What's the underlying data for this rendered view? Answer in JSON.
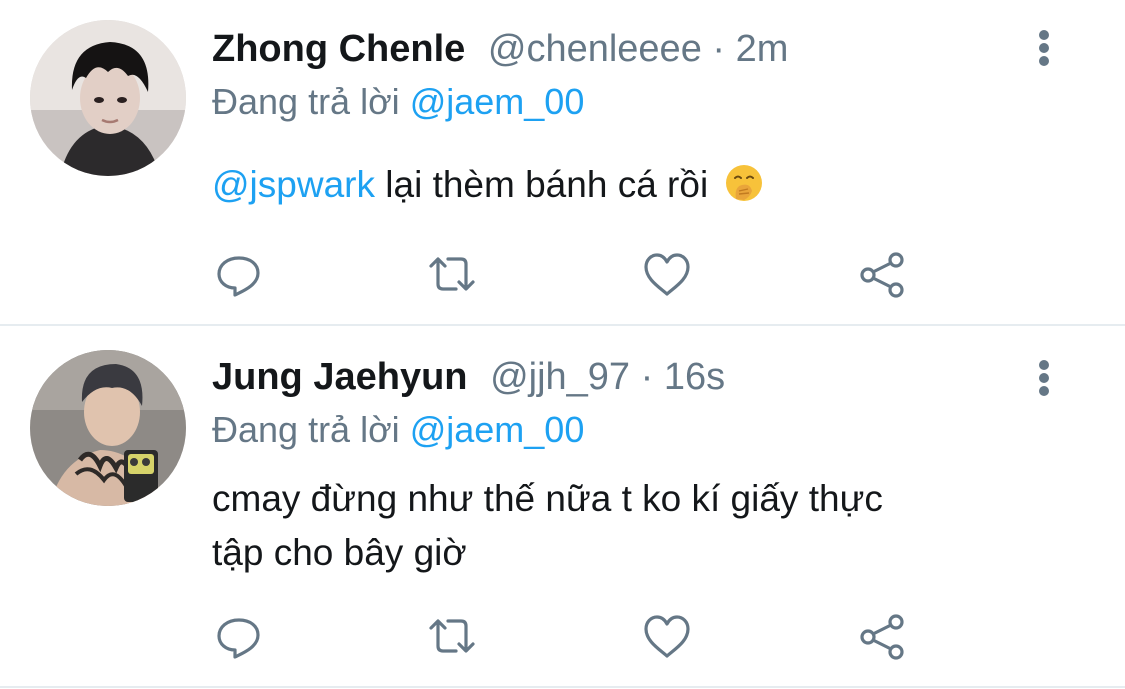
{
  "tweets": [
    {
      "name": "Zhong Chenle",
      "handle": "@chenleeee",
      "separator": "·",
      "time": "2m",
      "reply_prefix": "Đang trả lời",
      "reply_to": "@jaem_00",
      "mention": "@jspwark",
      "text": "lại thèm bánh cá rồi",
      "emoji": "hand-over-mouth-emoji"
    },
    {
      "name": "Jung Jaehyun",
      "handle": "@jjh_97",
      "separator": "·",
      "time": "16s",
      "reply_prefix": "Đang trả lời",
      "reply_to": "@jaem_00",
      "text_line1": "cmay đừng như thế nữa t ko kí giấy thực",
      "text_line2": "tập cho bây giờ"
    }
  ],
  "icons": {
    "reply": "comment-icon",
    "retweet": "retweet-icon",
    "like": "heart-icon",
    "share": "share-icon",
    "more": "more-vertical-icon"
  },
  "colors": {
    "link": "#1da1f2",
    "secondary": "#657786",
    "primary": "#14171a",
    "divider": "#e6ecf0"
  }
}
